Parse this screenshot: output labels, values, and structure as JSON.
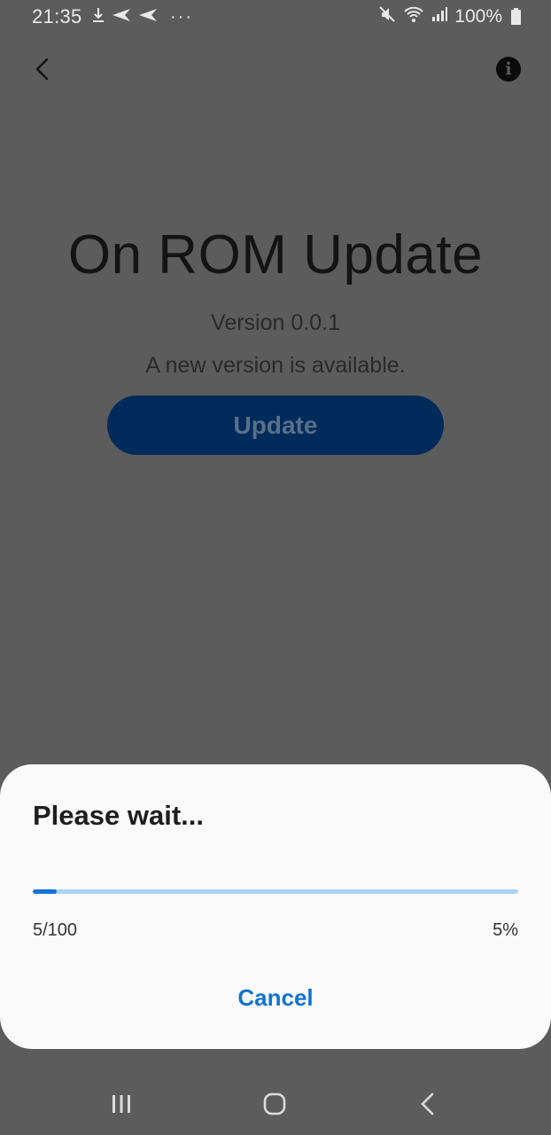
{
  "status_bar": {
    "time": "21:35",
    "battery": "100%",
    "icons": [
      "download-icon",
      "send-icon",
      "send-icon",
      "more-dots-icon",
      "mute-icon",
      "wifi-icon",
      "signal-icon",
      "battery-icon"
    ],
    "more": "···"
  },
  "app": {
    "title": "On ROM Update",
    "version": "Version 0.0.1",
    "message": "A new version is available.",
    "update_label": "Update",
    "info_glyph": "i"
  },
  "dialog": {
    "title": "Please wait...",
    "progress_count": "5/100",
    "progress_percent": "5%",
    "progress_value": 0.05,
    "cancel_label": "Cancel"
  },
  "colors": {
    "background": "#5c5c5c",
    "accent": "#1174cf",
    "progress_fill": "#0f73d9",
    "progress_track": "#a9d3f3",
    "update_button": "#002b5b"
  }
}
